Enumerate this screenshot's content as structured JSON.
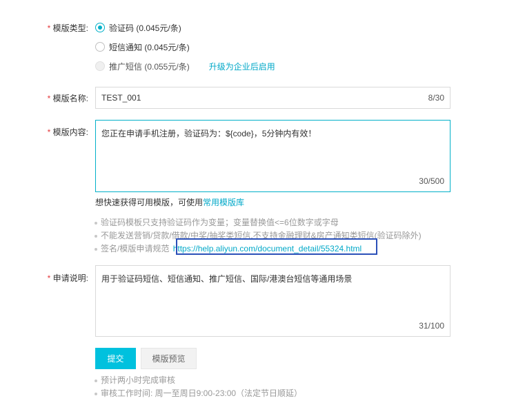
{
  "template_type": {
    "label": "模版类型:",
    "options": [
      {
        "text": "验证码 (0.045元/条)",
        "state": "checked"
      },
      {
        "text": "短信通知 (0.045元/条)",
        "state": "unchecked"
      },
      {
        "text": "推广短信 (0.055元/条)",
        "state": "disabled"
      }
    ],
    "upgrade_link": "升级为企业后启用"
  },
  "template_name": {
    "label": "模版名称:",
    "value": "TEST_001",
    "counter": "8/30"
  },
  "template_content": {
    "label": "模版内容:",
    "value": "您正在申请手机注册，验证码为：${code}，5分钟内有效！",
    "counter": "30/500"
  },
  "quick_hint": {
    "text": "想快速获得可用模版，可使用",
    "link": "常用模版库"
  },
  "rules": {
    "items": [
      "验证码模板只支持验证码作为变量；变量替换值<=6位数字或字母",
      "不能发送营销/贷款/借款/中奖/抽奖类短信,不支持金融理财&房产通知类短信(验证码除外)"
    ],
    "spec_prefix": "签名/模版申请规范",
    "spec_link": "https://help.aliyun.com/document_detail/55324.html"
  },
  "application_note": {
    "label": "申请说明:",
    "value": "用于验证码短信、短信通知、推广短信、国际/港澳台短信等通用场景",
    "counter": "31/100"
  },
  "buttons": {
    "submit": "提交",
    "preview": "模版预览"
  },
  "footer_tips": [
    "预计两小时完成审核",
    "审核工作时间: 周一至周日9:00-23:00（法定节日顺延）"
  ],
  "colors": {
    "accent": "#00c1de",
    "required": "#e4393c",
    "highlight_box": "#2a4fb8"
  }
}
